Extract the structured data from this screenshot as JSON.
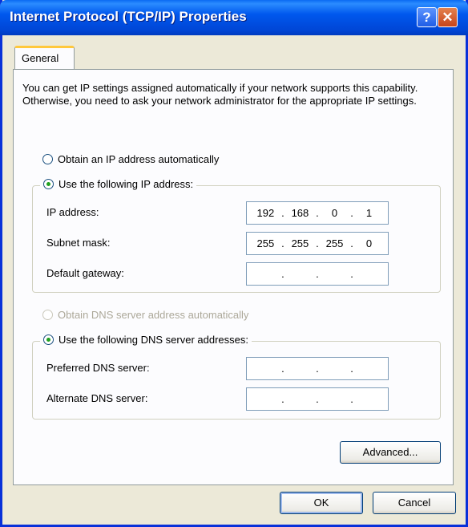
{
  "window": {
    "title": "Internet Protocol (TCP/IP) Properties"
  },
  "titlebar_buttons": {
    "help": "?",
    "close": "✕"
  },
  "tab": {
    "label": "General"
  },
  "description": "You can get IP settings assigned automatically if your network supports this capability. Otherwise, you need to ask your network administrator for the appropriate IP settings.",
  "ip": {
    "auto_label": "Obtain an IP address automatically",
    "manual_label": "Use the following IP address:",
    "selected": "manual",
    "fields": [
      {
        "label": "IP address:",
        "octets": [
          "192",
          "168",
          "0",
          "1"
        ]
      },
      {
        "label": "Subnet mask:",
        "octets": [
          "255",
          "255",
          "255",
          "0"
        ]
      },
      {
        "label": "Default gateway:",
        "octets": [
          "",
          "",
          "",
          ""
        ]
      }
    ]
  },
  "dns": {
    "auto_label": "Obtain DNS server address automatically",
    "auto_enabled": false,
    "manual_label": "Use the following DNS server addresses:",
    "selected": "manual",
    "fields": [
      {
        "label": "Preferred DNS server:",
        "octets": [
          "",
          "",
          "",
          ""
        ]
      },
      {
        "label": "Alternate DNS server:",
        "octets": [
          "",
          "",
          "",
          ""
        ]
      }
    ]
  },
  "buttons": {
    "advanced": "Advanced...",
    "ok": "OK",
    "cancel": "Cancel"
  },
  "colors": {
    "title_bar": "#0058EE",
    "dialog_bg": "#ECE9D8",
    "tab_highlight": "#FFC83C",
    "radio_dot": "#21A121"
  }
}
